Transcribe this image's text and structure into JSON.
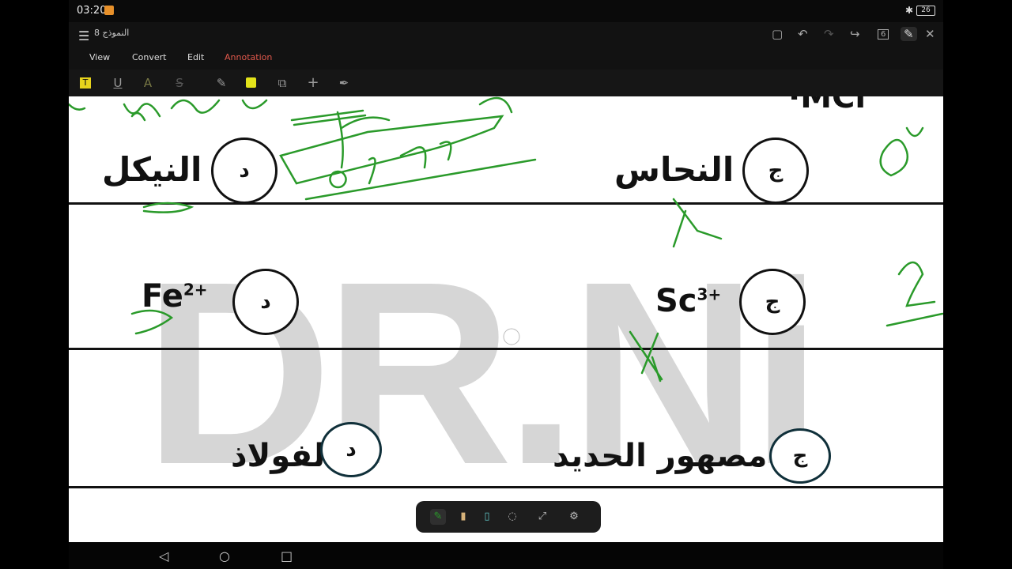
{
  "status": {
    "time": "03:20",
    "battery": "26"
  },
  "app": {
    "title": "النموذج 8",
    "menu_icon": "menu-icon",
    "tabs": [
      "View",
      "Convert",
      "Edit",
      "Annotation"
    ],
    "active_tab": "Annotation",
    "right_icons": [
      "save-icon",
      "undo-icon",
      "redo-icon",
      "share-icon",
      "pages-icon",
      "edit-icon",
      "close-icon"
    ],
    "page_count_badge": "6"
  },
  "toolbar": {
    "tools": [
      "highlight-icon",
      "underline-icon",
      "text-color-icon",
      "strikethrough-icon",
      "pen-icon",
      "highlighter-box-icon",
      "shapes-icon",
      "add-icon",
      "signature-icon"
    ]
  },
  "document": {
    "rows": [
      {
        "left_label": "النيكل",
        "left_choice": "د",
        "right_label": "النحاس",
        "right_choice": "ج"
      },
      {
        "left_formula": "Fe",
        "left_charge": "2+",
        "left_choice": "د",
        "right_formula": "Sc",
        "right_charge": "3+",
        "right_choice": "ج"
      },
      {
        "left_label": "الفولاذ",
        "left_choice": "د",
        "right_label": "مصهور الحديد",
        "right_choice": "ج"
      }
    ],
    "watermark": "DR.Ni"
  },
  "pen_panel": {
    "tools": [
      "green-pen-icon",
      "marker-icon",
      "eraser-icon",
      "lasso-icon",
      "shape-recognize-icon",
      "settings-icon"
    ]
  },
  "navbar": {
    "icons": [
      "back-icon",
      "home-icon",
      "recents-icon"
    ]
  }
}
